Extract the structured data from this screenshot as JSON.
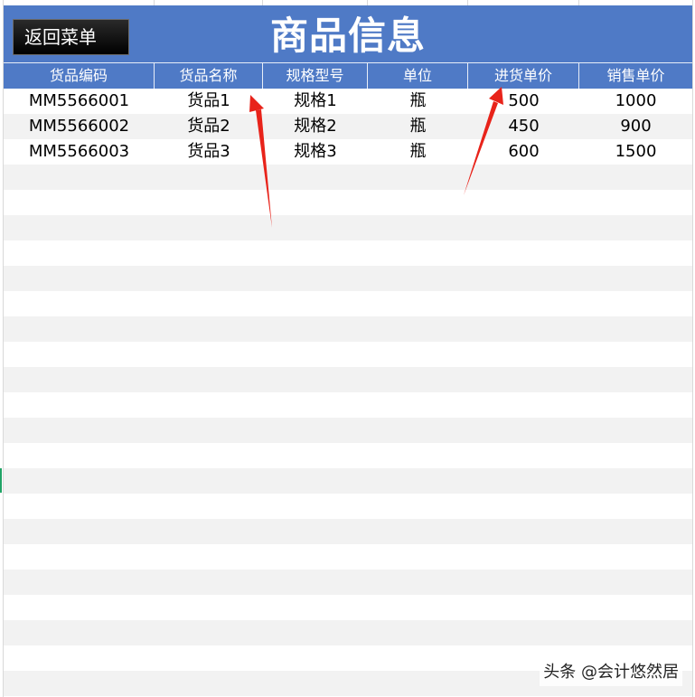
{
  "sheet": {
    "back_button_label": "返回菜单",
    "title": "商品信息"
  },
  "table": {
    "columns": [
      "货品编码",
      "货品名称",
      "规格型号",
      "单位",
      "进货单价",
      "销售单价"
    ],
    "rows": [
      [
        "MM5566001",
        "货品1",
        "规格1",
        "瓶",
        "500",
        "1000"
      ],
      [
        "MM5566002",
        "货品2",
        "规格2",
        "瓶",
        "450",
        "900"
      ],
      [
        "MM5566003",
        "货品3",
        "规格3",
        "瓶",
        "600",
        "1500"
      ]
    ],
    "empty_row_count": 21
  },
  "colors": {
    "header_blue": "#4f7ac6",
    "stripe_gray": "#f2f2f2",
    "arrow_red": "#e8231a",
    "button_black": "#000000"
  },
  "watermark": "头条 @会计悠然居"
}
